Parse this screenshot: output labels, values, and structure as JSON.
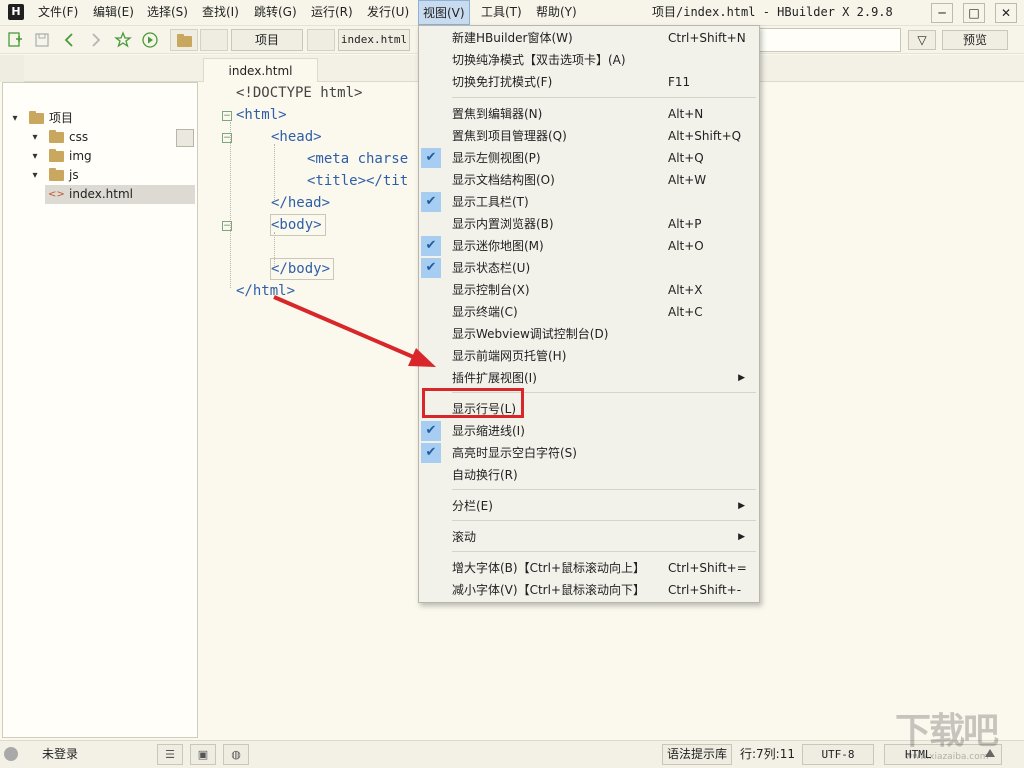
{
  "menubar": {
    "logo": "H",
    "items": [
      {
        "label": "文件(F)"
      },
      {
        "label": "编辑(E)"
      },
      {
        "label": "选择(S)"
      },
      {
        "label": "查找(I)"
      },
      {
        "label": "跳转(G)"
      },
      {
        "label": "运行(R)"
      },
      {
        "label": "发行(U)"
      },
      {
        "label": "视图(V)",
        "active": true
      },
      {
        "label": "工具(T)"
      },
      {
        "label": "帮助(Y)"
      }
    ],
    "window_title": "项目/index.html - HBuilder X 2.9.8",
    "window_buttons": [
      "─",
      "□",
      "✕"
    ]
  },
  "toolbar": {
    "icons": [
      "new-file-icon",
      "save-icon",
      "back-icon",
      "forward-icon",
      "favorite-icon",
      "run-icon",
      "folder-icon"
    ],
    "crumb_project": "项目",
    "crumb_file": "index.html",
    "search": {
      "value": "",
      "placeholder": ""
    },
    "filter_glyph": "▽",
    "preview_label": "预览"
  },
  "tabs": [
    {
      "label": "index.html",
      "active": true
    }
  ],
  "explorer": {
    "items": [
      {
        "label": "项目",
        "type": "folder",
        "expanded": true,
        "level": 0
      },
      {
        "label": "css",
        "type": "folder",
        "expanded": true,
        "level": 1
      },
      {
        "label": "img",
        "type": "folder",
        "expanded": true,
        "level": 1
      },
      {
        "label": "js",
        "type": "folder",
        "expanded": true,
        "level": 1
      },
      {
        "label": "index.html",
        "type": "file",
        "level": 1,
        "selected": true
      }
    ]
  },
  "editor": {
    "lines": [
      "<!DOCTYPE html>",
      "<html>",
      "<head>",
      "<meta charse",
      "<title></tit",
      "</head>",
      "<body>",
      "",
      "</body>",
      "</html>"
    ]
  },
  "view_menu": {
    "items": [
      {
        "label": "新建HBuilder窗体(W)",
        "shortcut": "Ctrl+Shift+N",
        "checked": false
      },
      {
        "label": "切换纯净模式【双击选项卡】(A)",
        "shortcut": "",
        "checked": false
      },
      {
        "label": "切换免打扰模式(F)",
        "shortcut": "F11",
        "checked": false
      },
      {
        "label": "置焦到编辑器(N)",
        "shortcut": "Alt+N",
        "checked": false
      },
      {
        "label": "置焦到项目管理器(Q)",
        "shortcut": "Alt+Shift+Q",
        "checked": false
      },
      {
        "label": "显示左侧视图(P)",
        "shortcut": "Alt+Q",
        "checked": true
      },
      {
        "label": "显示文档结构图(O)",
        "shortcut": "Alt+W",
        "checked": false
      },
      {
        "label": "显示工具栏(T)",
        "shortcut": "",
        "checked": true
      },
      {
        "label": "显示内置浏览器(B)",
        "shortcut": "Alt+P",
        "checked": false
      },
      {
        "label": "显示迷你地图(M)",
        "shortcut": "Alt+O",
        "checked": true
      },
      {
        "label": "显示状态栏(U)",
        "shortcut": "",
        "checked": true
      },
      {
        "label": "显示控制台(X)",
        "shortcut": "Alt+X",
        "checked": false
      },
      {
        "label": "显示终端(C)",
        "shortcut": "Alt+C",
        "checked": false
      },
      {
        "label": "显示Webview调试控制台(D)",
        "shortcut": "",
        "checked": false
      },
      {
        "label": "显示前端网页托管(H)",
        "shortcut": "",
        "checked": false
      },
      {
        "label": "插件扩展视图(I)",
        "shortcut": "",
        "checked": false,
        "submenu": true
      },
      {
        "label": "显示行号(L)",
        "shortcut": "",
        "checked": false
      },
      {
        "label": "显示缩进线(I)",
        "shortcut": "",
        "checked": true
      },
      {
        "label": "高亮时显示空白字符(S)",
        "shortcut": "",
        "checked": true
      },
      {
        "label": "自动换行(R)",
        "shortcut": "",
        "checked": false
      },
      {
        "label": "分栏(E)",
        "shortcut": "",
        "checked": false,
        "submenu": true
      },
      {
        "label": "滚动",
        "shortcut": "",
        "checked": false,
        "submenu": true
      },
      {
        "label": "增大字体(B)【Ctrl+鼠标滚动向上】",
        "shortcut": "Ctrl+Shift+=",
        "checked": false
      },
      {
        "label": "减小字体(V)【Ctrl+鼠标滚动向下】",
        "shortcut": "Ctrl+Shift+-",
        "checked": false
      }
    ],
    "check_glyph": "✔",
    "submenu_glyph": "▶"
  },
  "statusbar": {
    "login": "未登录",
    "lang_lib": "语法提示库",
    "cursor": "行:7列:11",
    "encoding": "UTF-8",
    "syntax": "HTML"
  },
  "watermark": {
    "text": "下载吧",
    "url": "www.xiazaiba.com"
  },
  "colors": {
    "menu_active": "#c9dcef",
    "check_bg": "#a8cdf2",
    "annotation_red": "#d8262a",
    "tag_blue": "#2f5ea8",
    "attr_orange": "#b55a2a",
    "folder": "#c9a75f"
  }
}
